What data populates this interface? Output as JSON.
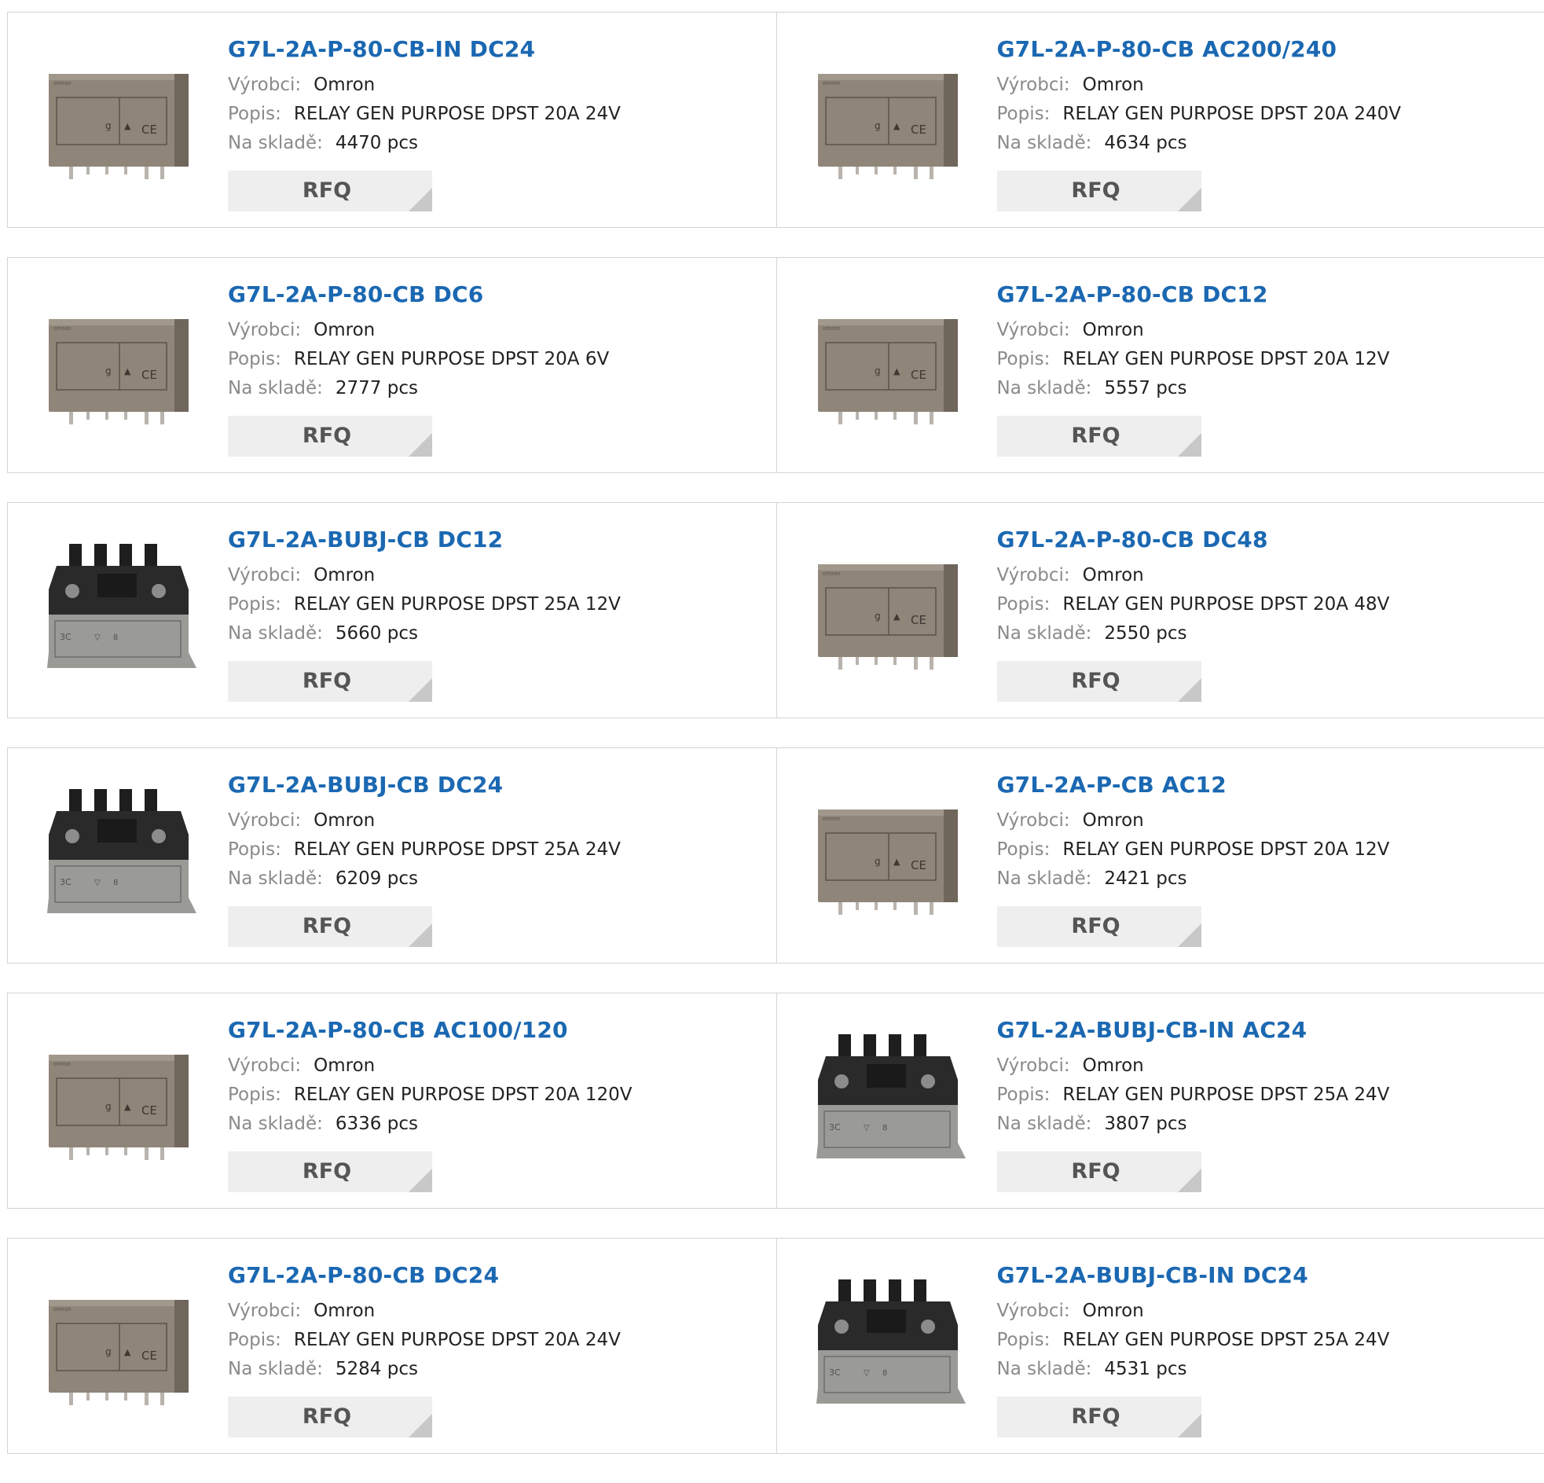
{
  "labels": {
    "manufacturer": "Výrobci:",
    "description": "Popis:",
    "stock": "Na skladě:",
    "rfq": "RFQ"
  },
  "colors": {
    "title_link": "#1b68b2",
    "label_gray": "#8a8a8a",
    "rfq_bg": "#eeeeee",
    "border": "#d4d4d4"
  },
  "products": [
    {
      "title": "G7L-2A-P-80-CB-IN DC24",
      "manufacturer": "Omron",
      "description": "RELAY GEN PURPOSE DPST 20A 24V",
      "stock": "4470 pcs",
      "image": "relay-brown-icon"
    },
    {
      "title": "G7L-2A-P-80-CB AC200/240",
      "manufacturer": "Omron",
      "description": "RELAY GEN PURPOSE DPST 20A 240V",
      "stock": "4634 pcs",
      "image": "relay-brown-icon"
    },
    {
      "title": "G7L-2A-P-80-CB DC6",
      "manufacturer": "Omron",
      "description": "RELAY GEN PURPOSE DPST 20A 6V",
      "stock": "2777 pcs",
      "image": "relay-brown-icon"
    },
    {
      "title": "G7L-2A-P-80-CB DC12",
      "manufacturer": "Omron",
      "description": "RELAY GEN PURPOSE DPST 20A 12V",
      "stock": "5557 pcs",
      "image": "relay-brown-icon"
    },
    {
      "title": "G7L-2A-BUBJ-CB DC12",
      "manufacturer": "Omron",
      "description": "RELAY GEN PURPOSE DPST 25A 12V",
      "stock": "5660 pcs",
      "image": "relay-black-icon"
    },
    {
      "title": "G7L-2A-P-80-CB DC48",
      "manufacturer": "Omron",
      "description": "RELAY GEN PURPOSE DPST 20A 48V",
      "stock": "2550 pcs",
      "image": "relay-brown-icon"
    },
    {
      "title": "G7L-2A-BUBJ-CB DC24",
      "manufacturer": "Omron",
      "description": "RELAY GEN PURPOSE DPST 25A 24V",
      "stock": "6209 pcs",
      "image": "relay-black-icon"
    },
    {
      "title": "G7L-2A-P-CB AC12",
      "manufacturer": "Omron",
      "description": "RELAY GEN PURPOSE DPST 20A 12V",
      "stock": "2421 pcs",
      "image": "relay-brown-icon"
    },
    {
      "title": "G7L-2A-P-80-CB AC100/120",
      "manufacturer": "Omron",
      "description": "RELAY GEN PURPOSE DPST 20A 120V",
      "stock": "6336 pcs",
      "image": "relay-brown-icon"
    },
    {
      "title": "G7L-2A-BUBJ-CB-IN AC24",
      "manufacturer": "Omron",
      "description": "RELAY GEN PURPOSE DPST 25A 24V",
      "stock": "3807 pcs",
      "image": "relay-black-icon"
    },
    {
      "title": "G7L-2A-P-80-CB DC24",
      "manufacturer": "Omron",
      "description": "RELAY GEN PURPOSE DPST 20A 24V",
      "stock": "5284 pcs",
      "image": "relay-brown-icon"
    },
    {
      "title": "G7L-2A-BUBJ-CB-IN DC24",
      "manufacturer": "Omron",
      "description": "RELAY GEN PURPOSE DPST 25A 24V",
      "stock": "4531 pcs",
      "image": "relay-black-icon"
    }
  ]
}
